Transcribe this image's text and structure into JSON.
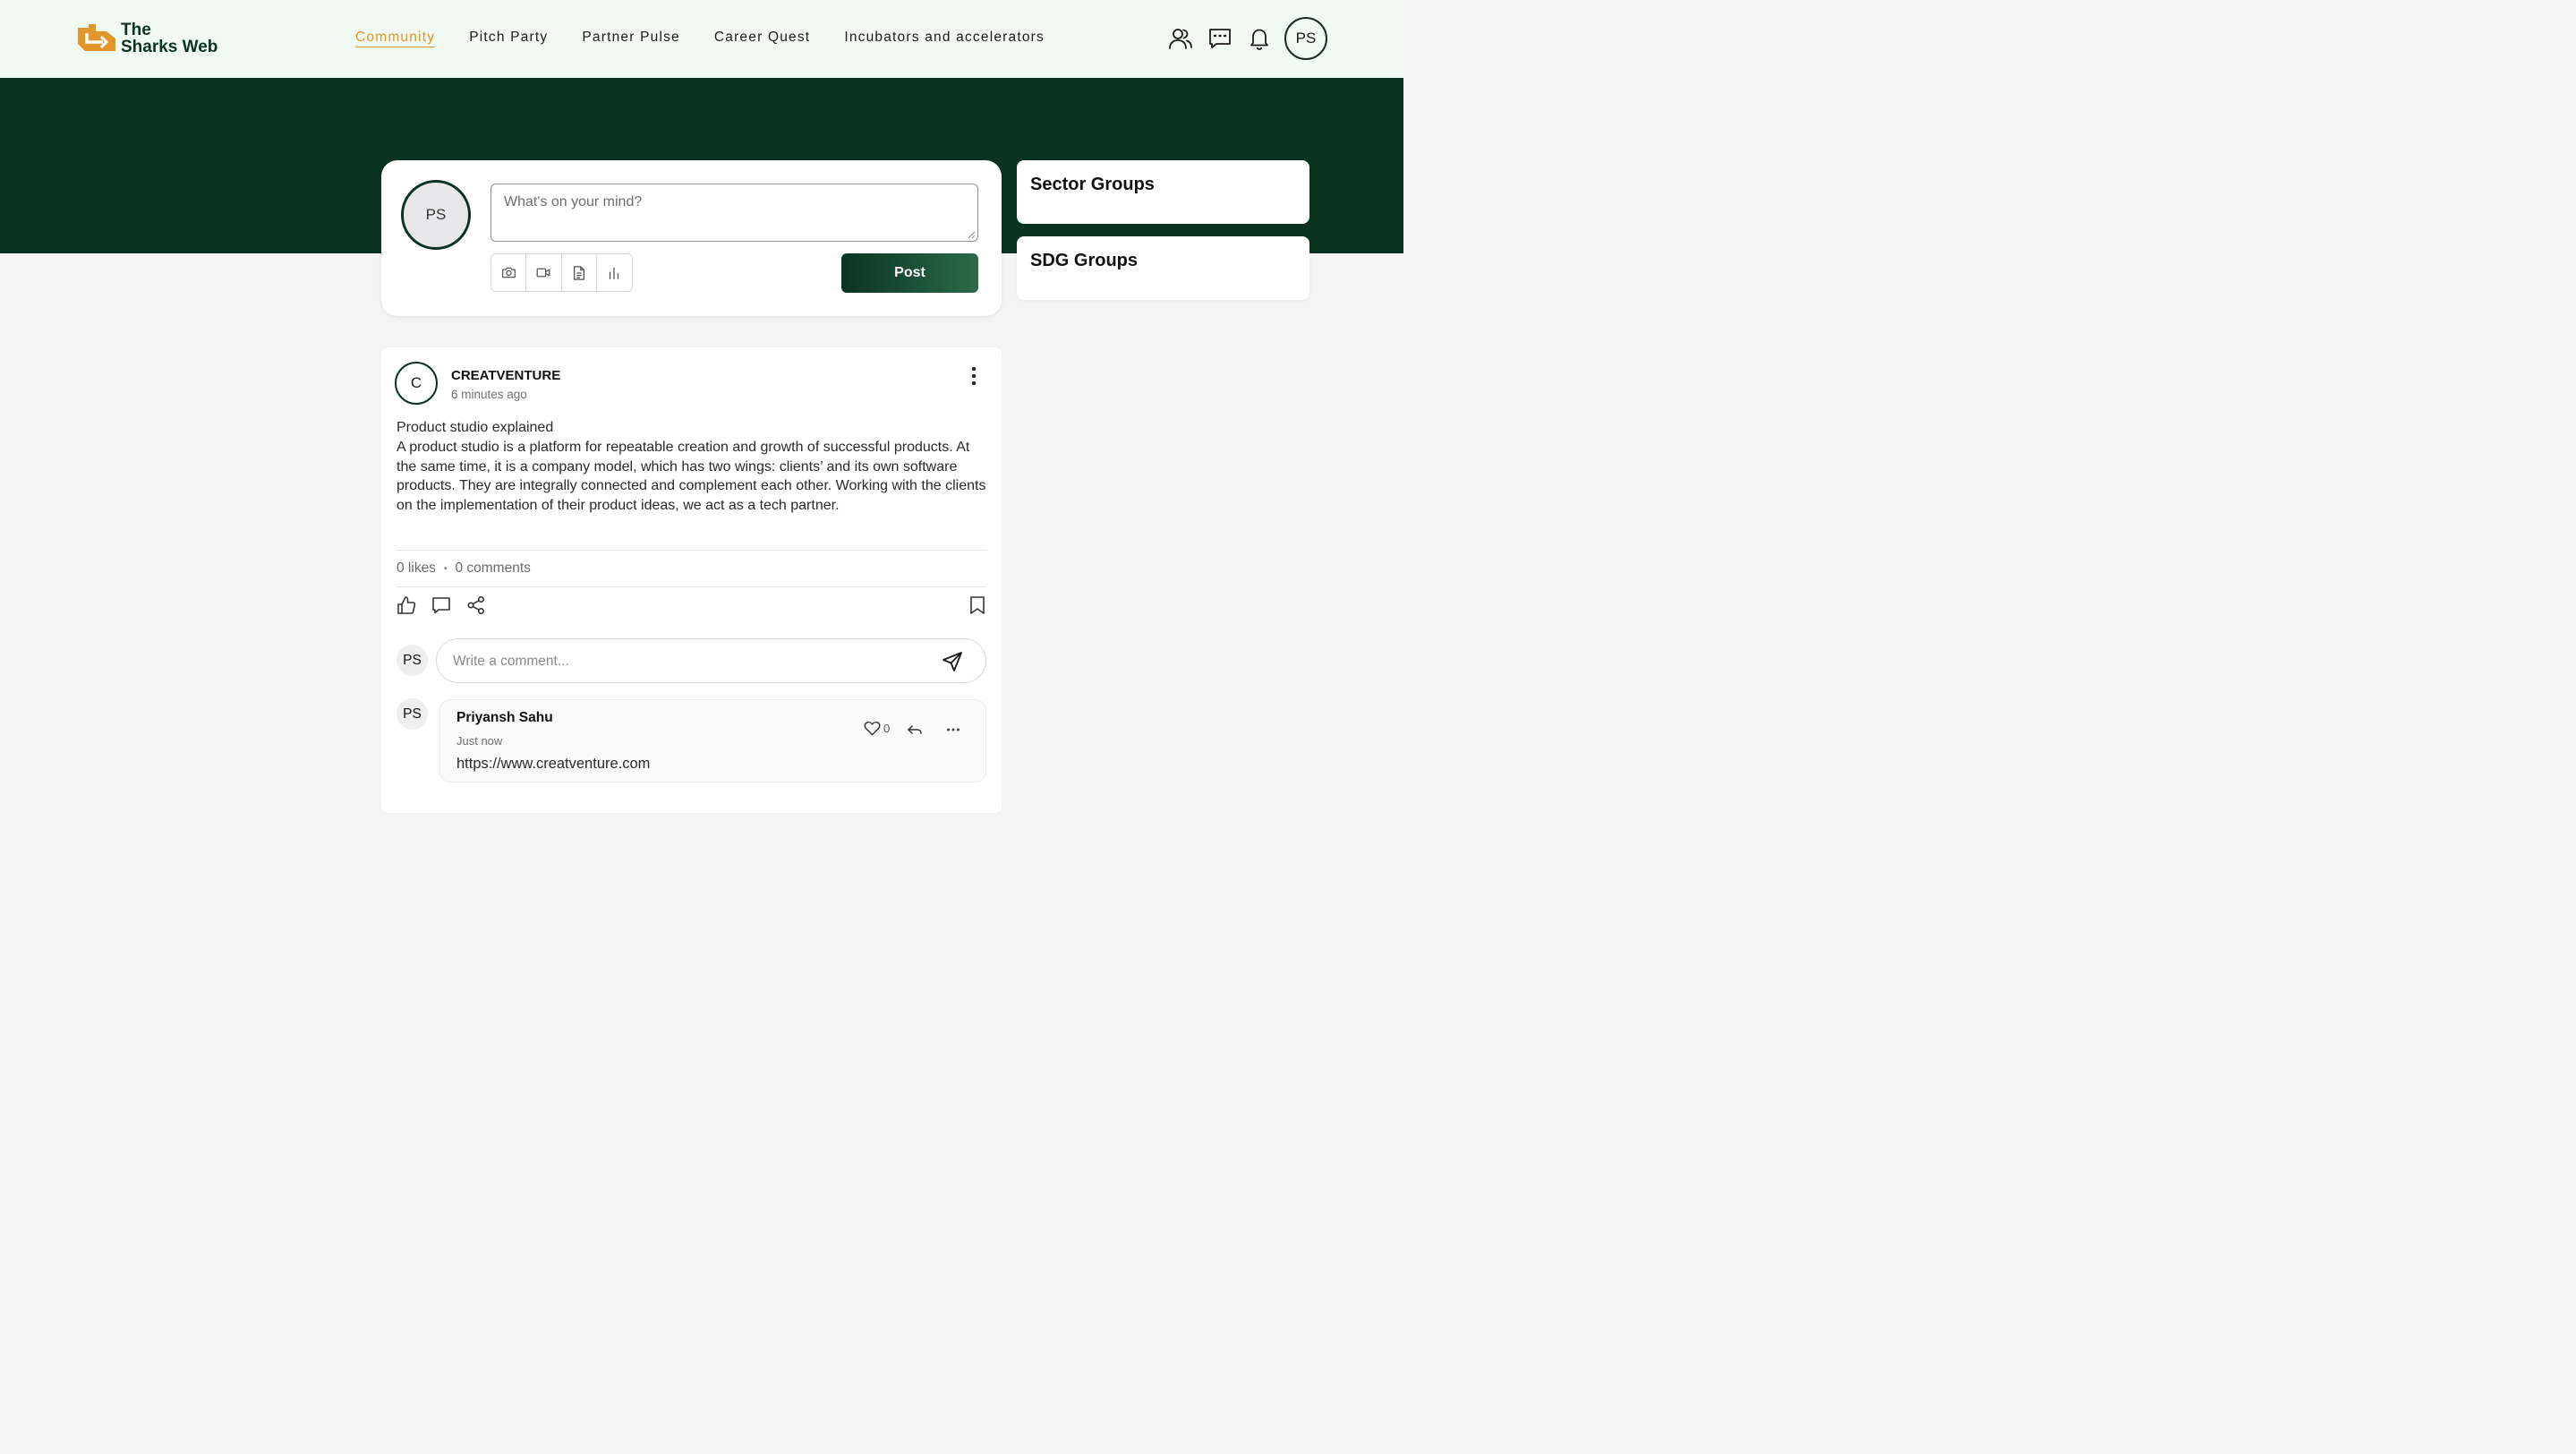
{
  "brand": {
    "line1": "The",
    "line2": "Sharks Web",
    "accent": "#e0962a",
    "dark": "#0a3322"
  },
  "nav": {
    "links": [
      {
        "label": "Community",
        "active": true
      },
      {
        "label": "Pitch Party",
        "active": false
      },
      {
        "label": "Partner Pulse",
        "active": false
      },
      {
        "label": "Career Quest",
        "active": false
      },
      {
        "label": "Incubators and accelerators",
        "active": false
      }
    ],
    "icons": [
      "users-icon",
      "message-icon",
      "bell-icon"
    ],
    "avatar": "PS"
  },
  "composer": {
    "avatar": "PS",
    "placeholder": "What's on your mind?",
    "tools": [
      "camera-icon",
      "video-icon",
      "document-icon",
      "poll-icon"
    ],
    "post_label": "Post"
  },
  "sidebar": {
    "cards": [
      "Sector Groups",
      "SDG Groups"
    ]
  },
  "post": {
    "author_initial": "C",
    "author": "CREATVENTURE",
    "time": "6 minutes ago",
    "body": "Product studio explained\nA product studio is a platform for repeatable creation and growth of successful products. At the same time, it is a company model, which has two wings: clients’ and its own software products. They are integrally connected and complement each other. Working with the clients on the implementation of their product ideas, we act as a tech partner.",
    "likes": "0 likes",
    "separator": "•",
    "comments": "0 comments",
    "comment_avatar": "PS",
    "comment_placeholder": "Write a comment...",
    "comment_list": [
      {
        "avatar": "PS",
        "name": "Priyansh Sahu",
        "time": "Just now",
        "text": "https://www.creatventure.com",
        "likes": "0"
      }
    ]
  }
}
